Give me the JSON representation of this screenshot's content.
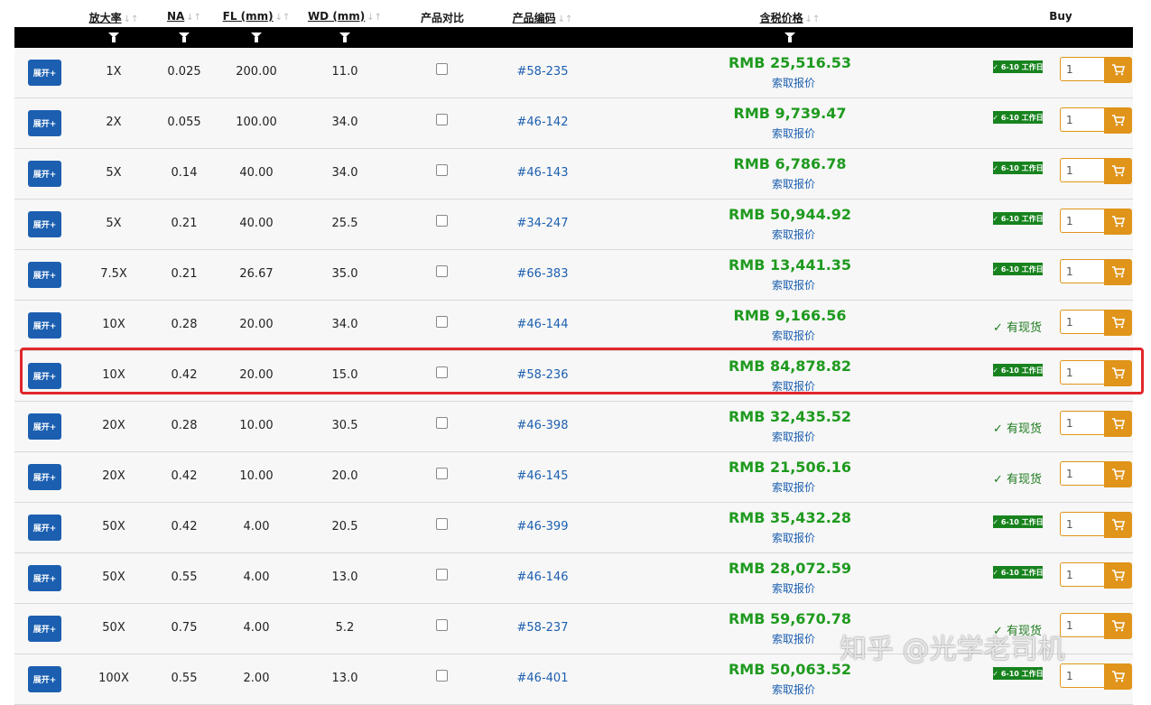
{
  "headers": {
    "magnification": "放大率",
    "na": "NA",
    "fl": "FL (mm)",
    "wd": "WD (mm)",
    "compare": "产品对比",
    "code": "产品编码",
    "price": "含税价格",
    "buy": "Buy"
  },
  "sort_glyph": "↓↑",
  "expand_label": "展开+",
  "quote_label": "索取报价",
  "in_stock_label": "✓ 有现货",
  "badge_label": "✓ 6-10 工作日",
  "icons": {
    "filter": "funnel-icon",
    "cart": "cart-icon",
    "check": "checkbox"
  },
  "colors": {
    "price": "#1e9a1e",
    "link": "#1c5fb0",
    "button": "#1c5fb0",
    "cart": "#e0941a",
    "highlight": "#e0262b",
    "badge": "#18831e"
  },
  "rows": [
    {
      "mag": "1X",
      "na": "0.025",
      "fl": "200.00",
      "wd": "11.0",
      "code": "#58-235",
      "price": "RMB 25,516.53",
      "availability": "badge",
      "qty": "1"
    },
    {
      "mag": "2X",
      "na": "0.055",
      "fl": "100.00",
      "wd": "34.0",
      "code": "#46-142",
      "price": "RMB 9,739.47",
      "availability": "badge",
      "qty": "1"
    },
    {
      "mag": "5X",
      "na": "0.14",
      "fl": "40.00",
      "wd": "34.0",
      "code": "#46-143",
      "price": "RMB 6,786.78",
      "availability": "badge",
      "qty": "1"
    },
    {
      "mag": "5X",
      "na": "0.21",
      "fl": "40.00",
      "wd": "25.5",
      "code": "#34-247",
      "price": "RMB 50,944.92",
      "availability": "badge",
      "qty": "1"
    },
    {
      "mag": "7.5X",
      "na": "0.21",
      "fl": "26.67",
      "wd": "35.0",
      "code": "#66-383",
      "price": "RMB 13,441.35",
      "availability": "badge",
      "qty": "1"
    },
    {
      "mag": "10X",
      "na": "0.28",
      "fl": "20.00",
      "wd": "34.0",
      "code": "#46-144",
      "price": "RMB 9,166.56",
      "availability": "stock",
      "qty": "1"
    },
    {
      "mag": "10X",
      "na": "0.42",
      "fl": "20.00",
      "wd": "15.0",
      "code": "#58-236",
      "price": "RMB 84,878.82",
      "availability": "badge",
      "qty": "1"
    },
    {
      "mag": "20X",
      "na": "0.28",
      "fl": "10.00",
      "wd": "30.5",
      "code": "#46-398",
      "price": "RMB 32,435.52",
      "availability": "stock",
      "qty": "1"
    },
    {
      "mag": "20X",
      "na": "0.42",
      "fl": "10.00",
      "wd": "20.0",
      "code": "#46-145",
      "price": "RMB 21,506.16",
      "availability": "stock",
      "qty": "1"
    },
    {
      "mag": "50X",
      "na": "0.42",
      "fl": "4.00",
      "wd": "20.5",
      "code": "#46-399",
      "price": "RMB 35,432.28",
      "availability": "badge",
      "qty": "1"
    },
    {
      "mag": "50X",
      "na": "0.55",
      "fl": "4.00",
      "wd": "13.0",
      "code": "#46-146",
      "price": "RMB 28,072.59",
      "availability": "badge",
      "qty": "1"
    },
    {
      "mag": "50X",
      "na": "0.75",
      "fl": "4.00",
      "wd": "5.2",
      "code": "#58-237",
      "price": "RMB 59,670.78",
      "availability": "stock",
      "qty": "1"
    },
    {
      "mag": "100X",
      "na": "0.55",
      "fl": "2.00",
      "wd": "13.0",
      "code": "#46-401",
      "price": "RMB 50,063.52",
      "availability": "badge",
      "qty": "1"
    }
  ],
  "highlighted_row_code": "#58-236",
  "watermark": "知乎 @光学老司机"
}
